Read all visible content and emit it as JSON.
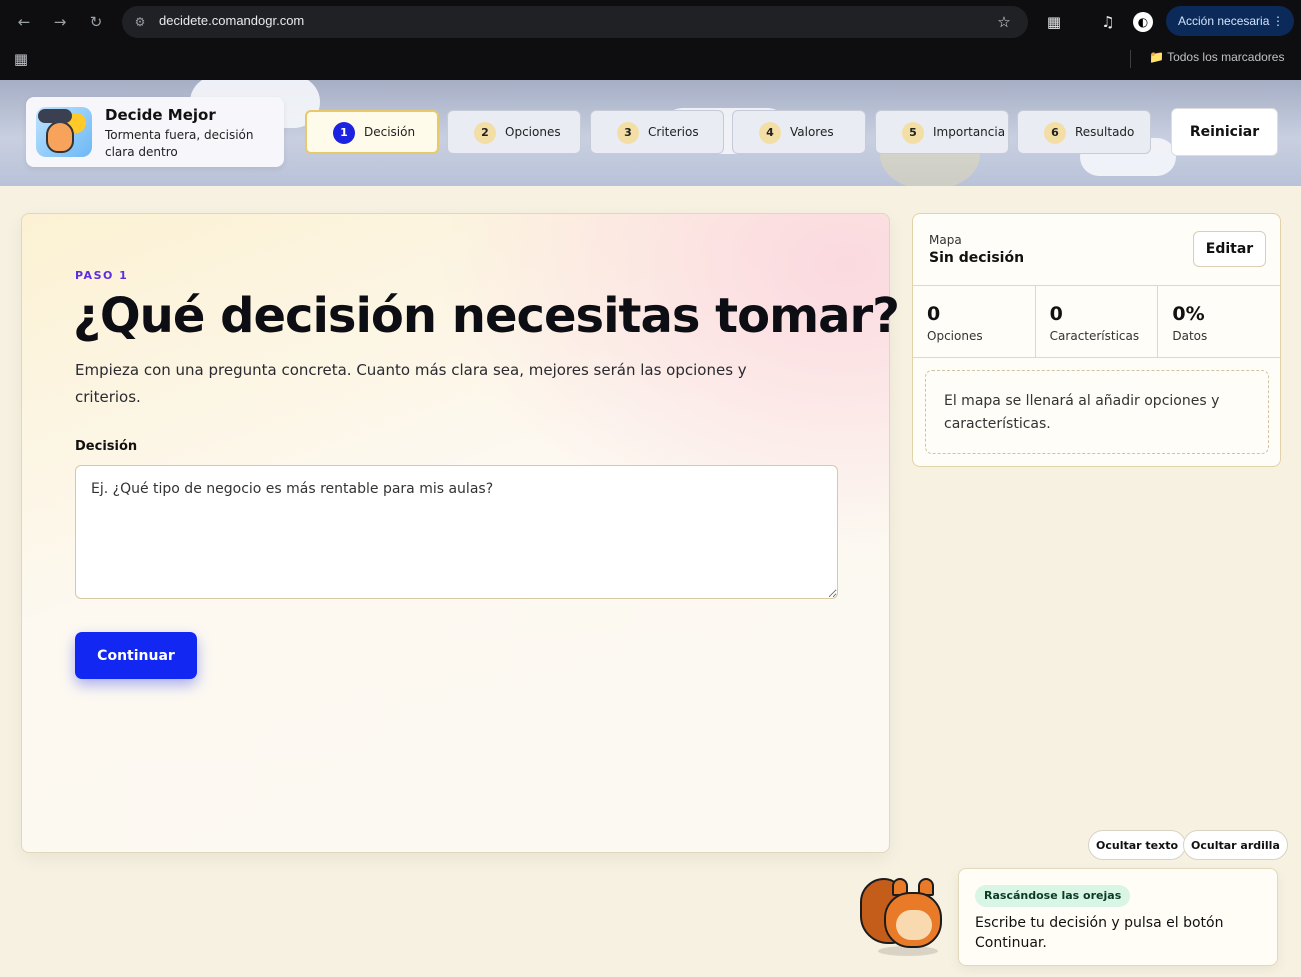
{
  "browser": {
    "url": "decidete.comandogr.com",
    "profile_chip": "Acción necesaria",
    "bookmarks_label": "Todos los marcadores"
  },
  "brand": {
    "title": "Decide Mejor",
    "subtitle": "Tormenta fuera, decisión clara dentro"
  },
  "steps": [
    {
      "num": "1",
      "label": "Decisión",
      "active": true
    },
    {
      "num": "2",
      "label": "Opciones"
    },
    {
      "num": "3",
      "label": "Criterios"
    },
    {
      "num": "4",
      "label": "Valores"
    },
    {
      "num": "5",
      "label": "Importancia"
    },
    {
      "num": "6",
      "label": "Resultado"
    }
  ],
  "reset_label": "Reiniciar",
  "main": {
    "step_tag": "PASO 1",
    "heading": "¿Qué decisión necesitas tomar?",
    "lead": "Empieza con una pregunta concreta. Cuanto más clara sea, mejores serán las opciones y criterios.",
    "field_label": "Decisión",
    "placeholder": "Ej. ¿Qué tipo de negocio es más rentable para mis aulas?",
    "value": "",
    "continue_label": "Continuar"
  },
  "map": {
    "kicker": "Mapa",
    "title": "Sin decisión",
    "edit_label": "Editar",
    "stats": [
      {
        "value": "0",
        "label": "Opciones"
      },
      {
        "value": "0",
        "label": "Características"
      },
      {
        "value": "0%",
        "label": "Datos"
      }
    ],
    "empty_text": "El mapa se llenará al añadir opciones y características."
  },
  "helper": {
    "hide_text_label": "Ocultar texto",
    "hide_squirrel_label": "Ocultar ardilla",
    "status": "Rascándose las orejas",
    "message": "Escribe tu decisión y pulsa el botón Continuar."
  },
  "colors": {
    "accent": "#1227f2",
    "step_tag": "#5b2ee0",
    "active_step_border": "#e8c96a"
  }
}
